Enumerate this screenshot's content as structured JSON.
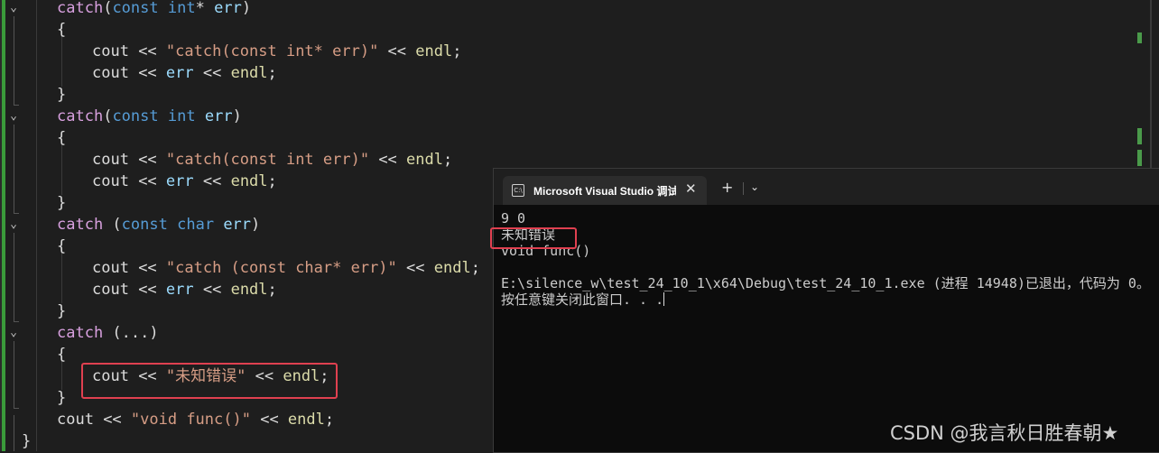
{
  "editor": {
    "lines": [
      {
        "kw1": "catch",
        "p1": "(",
        "kw2": "const",
        "sp": " ",
        "kw3": "int",
        "star": "*",
        "sp2": " ",
        "id": "err",
        "p2": ")"
      },
      {
        "brace": "{"
      },
      {
        "a": "cout",
        "op1": " << ",
        "s": "\"catch(const int* err)\"",
        "op2": " << ",
        "b": "endl",
        ";": ";"
      },
      {
        "a": "cout",
        "op1": " << ",
        "id": "err",
        "op2": " << ",
        "b": "endl",
        ";": ";"
      },
      {
        "brace": "}"
      },
      {
        "kw1": "catch",
        "p1": "(",
        "kw2": "const",
        "sp": " ",
        "kw3": "int",
        "sp2": " ",
        "id": "err",
        "p2": ")"
      },
      {
        "brace": "{"
      },
      {
        "a": "cout",
        "op1": " << ",
        "s": "\"catch(const int err)\"",
        "op2": " << ",
        "b": "endl",
        ";": ";"
      },
      {
        "a": "cout",
        "op1": " << ",
        "id": "err",
        "op2": " << ",
        "b": "endl",
        ";": ";"
      },
      {
        "brace": "}"
      },
      {
        "kw1": "catch",
        "p1": " (",
        "kw2": "const",
        "sp": " ",
        "kw3": "char",
        "sp2": " ",
        "id": "err",
        "p2": ")"
      },
      {
        "brace": "{"
      },
      {
        "a": "cout",
        "op1": " << ",
        "s": "\"catch (const char* err)\"",
        "op2": " << ",
        "b": "endl",
        ";": ";"
      },
      {
        "a": "cout",
        "op1": " << ",
        "id": "err",
        "op2": " << ",
        "b": "endl",
        ";": ";"
      },
      {
        "brace": "}"
      },
      {
        "kw1": "catch",
        "p1": " (...)"
      },
      {
        "brace": "{"
      },
      {
        "a": "cout",
        "op1": " << ",
        "s": "\"未知错误\"",
        "op2": " << ",
        "b": "endl",
        ";": ";"
      },
      {
        "brace": "}"
      },
      {
        "a": "cout",
        "op1": " << ",
        "s": "\"void func()\"",
        "op2": " << ",
        "b": "endl",
        ";": ";"
      },
      {
        "brace": "}"
      }
    ]
  },
  "terminal": {
    "tab_title": "Microsoft Visual Studio 调试控制台",
    "tab_icon": "C:\\",
    "close_glyph": "✕",
    "new_tab_glyph": "+",
    "dropdown_glyph": "⌄",
    "output": [
      "9 0",
      "未知错误",
      "void func()",
      "",
      "E:\\silence_w\\test_24_10_1\\x64\\Debug\\test_24_10_1.exe (进程 14948)已退出，代码为 0。",
      "按任意键关闭此窗口. . ."
    ]
  },
  "watermark": "CSDN @我言秋日胜春朝★",
  "colors": {
    "keyword": "#569cd6",
    "control": "#d8a0df",
    "string": "#d69d85",
    "identifier": "#9cdcfe",
    "function": "#dcdcaa",
    "highlight_box": "#e04050",
    "change_bar": "#3a9a3a"
  }
}
